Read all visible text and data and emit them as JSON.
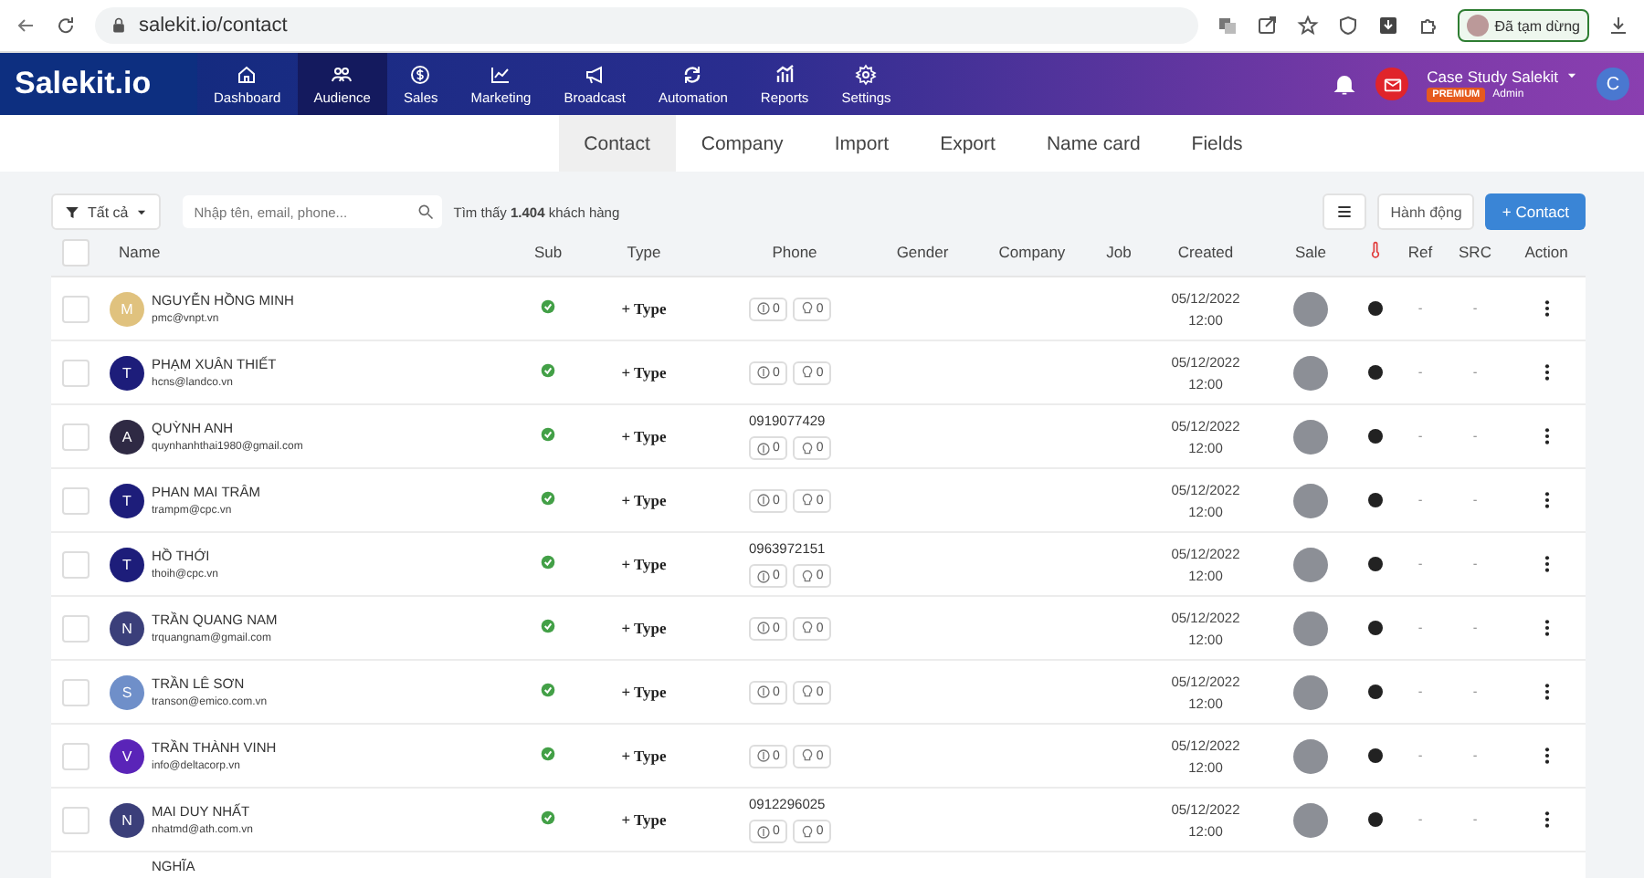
{
  "browser": {
    "url": "salekit.io/contact",
    "profile_button": "Đã tạm dừng"
  },
  "app_header": {
    "logo": "Salekit.io",
    "nav": [
      {
        "label": "Dashboard",
        "selected": false
      },
      {
        "label": "Audience",
        "selected": true
      },
      {
        "label": "Sales",
        "selected": false
      },
      {
        "label": "Marketing",
        "selected": false
      },
      {
        "label": "Broadcast",
        "selected": false
      },
      {
        "label": "Automation",
        "selected": false
      },
      {
        "label": "Reports",
        "selected": false
      },
      {
        "label": "Settings",
        "selected": false
      }
    ],
    "user": {
      "name": "Case Study Salekit",
      "badge": "PREMIUM",
      "role": "Admin",
      "avatar_initial": "C"
    }
  },
  "sub_tabs": [
    {
      "label": "Contact",
      "selected": true
    },
    {
      "label": "Company",
      "selected": false
    },
    {
      "label": "Import",
      "selected": false
    },
    {
      "label": "Export",
      "selected": false
    },
    {
      "label": "Name card",
      "selected": false
    },
    {
      "label": "Fields",
      "selected": false
    }
  ],
  "toolbar": {
    "select_all_checked": false,
    "filter": "Tất cả",
    "search": {
      "placeholder": "Nhập tên, email, phone..."
    },
    "result": "Tìm thấy **1.404** khách hàng",
    "action_button": "Hành động",
    "add_button": "+ Contact"
  },
  "table": {
    "columns": [
      "Name",
      "Sub",
      "Type",
      "Phone",
      "Gender",
      "Company",
      "Job",
      "Created",
      "Sale",
      "",
      "Ref",
      "SRC",
      "Action"
    ],
    "rows": [
      {
        "checked": false,
        "name": "NGUYỄN HỒNG MINH",
        "email": "pmc@vnpt.vn",
        "initial": "M",
        "color": "#e0c27e",
        "subscribed": true,
        "type": "+ Type",
        "phone": null,
        "deals": "0",
        "ideas": "0",
        "created": [
          "05/12/2022",
          "12:00"
        ],
        "ref": "-",
        "src": "-"
      },
      {
        "checked": false,
        "name": "PHẠM XUÂN THIẾT",
        "email": "hcns@landco.vn",
        "initial": "T",
        "color": "#1d1d7a",
        "subscribed": true,
        "type": "+ Type",
        "phone": null,
        "deals": "0",
        "ideas": "0",
        "created": [
          "05/12/2022",
          "12:00"
        ],
        "ref": "-",
        "src": "-"
      },
      {
        "checked": false,
        "name": "QUỲNH ANH",
        "email": "quynhanhthai1980@gmail.com",
        "initial": "A",
        "color": "#2f2a44",
        "subscribed": true,
        "type": "+ Type",
        "phone": "0919077429",
        "deals": "0",
        "ideas": "0",
        "created": [
          "05/12/2022",
          "12:00"
        ],
        "ref": "-",
        "src": "-"
      },
      {
        "checked": false,
        "name": "PHAN MAI TRÂM",
        "email": "trampm@cpc.vn",
        "initial": "T",
        "color": "#1d1d7a",
        "subscribed": true,
        "type": "+ Type",
        "phone": null,
        "deals": "0",
        "ideas": "0",
        "created": [
          "05/12/2022",
          "12:00"
        ],
        "ref": "-",
        "src": "-"
      },
      {
        "checked": false,
        "name": "HỒ THỚI",
        "email": "thoih@cpc.vn",
        "initial": "T",
        "color": "#1d1d7a",
        "subscribed": true,
        "type": "+ Type",
        "phone": "0963972151",
        "deals": "0",
        "ideas": "0",
        "created": [
          "05/12/2022",
          "12:00"
        ],
        "ref": "-",
        "src": "-"
      },
      {
        "checked": false,
        "name": "TRẦN QUANG NAM",
        "email": "trquangnam@gmail.com",
        "initial": "N",
        "color": "#3b3f7a",
        "subscribed": true,
        "type": "+ Type",
        "phone": null,
        "deals": "0",
        "ideas": "0",
        "created": [
          "05/12/2022",
          "12:00"
        ],
        "ref": "-",
        "src": "-"
      },
      {
        "checked": false,
        "name": "TRẦN LÊ SƠN",
        "email": "transon@emico.com.vn",
        "initial": "S",
        "color": "#6f8fc9",
        "subscribed": true,
        "type": "+ Type",
        "phone": null,
        "deals": "0",
        "ideas": "0",
        "created": [
          "05/12/2022",
          "12:00"
        ],
        "ref": "-",
        "src": "-"
      },
      {
        "checked": false,
        "name": "TRẦN THÀNH VINH",
        "email": "info@deltacorp.vn",
        "initial": "V",
        "color": "#5a24b8",
        "subscribed": true,
        "type": "+ Type",
        "phone": null,
        "deals": "0",
        "ideas": "0",
        "created": [
          "05/12/2022",
          "12:00"
        ],
        "ref": "-",
        "src": "-"
      },
      {
        "checked": false,
        "name": "MAI DUY NHẤT",
        "email": "nhatmd@ath.com.vn",
        "initial": "N",
        "color": "#3b3f7a",
        "subscribed": true,
        "type": "+ Type",
        "phone": "0912296025",
        "deals": "0",
        "ideas": "0",
        "created": [
          "05/12/2022",
          "12:00"
        ],
        "ref": "-",
        "src": "-"
      }
    ],
    "partial_row": {
      "name": "NGHĨA"
    }
  }
}
